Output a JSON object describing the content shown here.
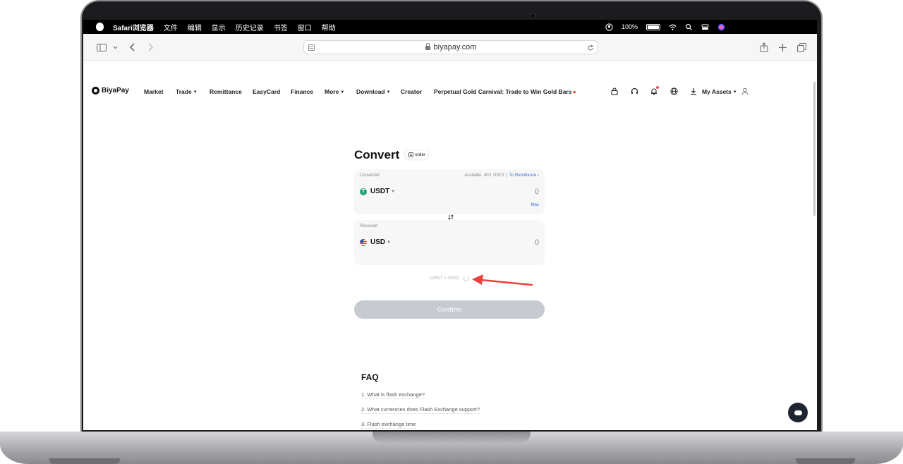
{
  "menubar": {
    "app": "Safari浏览器",
    "items": [
      "文件",
      "编辑",
      "显示",
      "历史记录",
      "书签",
      "窗口",
      "帮助"
    ],
    "battery": "100%"
  },
  "browser": {
    "url": "biyapay.com"
  },
  "nav": {
    "logo": "BiyaPay",
    "items": [
      "Market",
      "Trade",
      "Remittance",
      "EasyCard",
      "Finance",
      "More",
      "Download",
      "Creator"
    ],
    "promo": "Perpetual Gold Carnival: Trade to Win Gold Bars",
    "assets": "My Assets"
  },
  "convert": {
    "title": "Convert",
    "order_label": "order",
    "from": {
      "label": "Converted",
      "available_prefix": "Available",
      "available_amount": "400",
      "available_unit": "USDT",
      "remittance_link": "To Remittance",
      "currency": "USDT",
      "amount": "0",
      "max_label": "Max"
    },
    "to": {
      "label": "Received",
      "currency": "USD",
      "amount": "0"
    },
    "rate": "1USDT ≈ 1USD",
    "confirm_label": "Confirm"
  },
  "faq": {
    "title": "FAQ",
    "items": [
      "1. What is flash exchange?",
      "2. What currencies does Flash Exchange support?",
      "3. Flash exchange time"
    ]
  },
  "colors": {
    "accent_link": "#3a6fd8",
    "annotation_arrow": "#e8413a",
    "confirm_disabled": "#c7cbd1"
  }
}
